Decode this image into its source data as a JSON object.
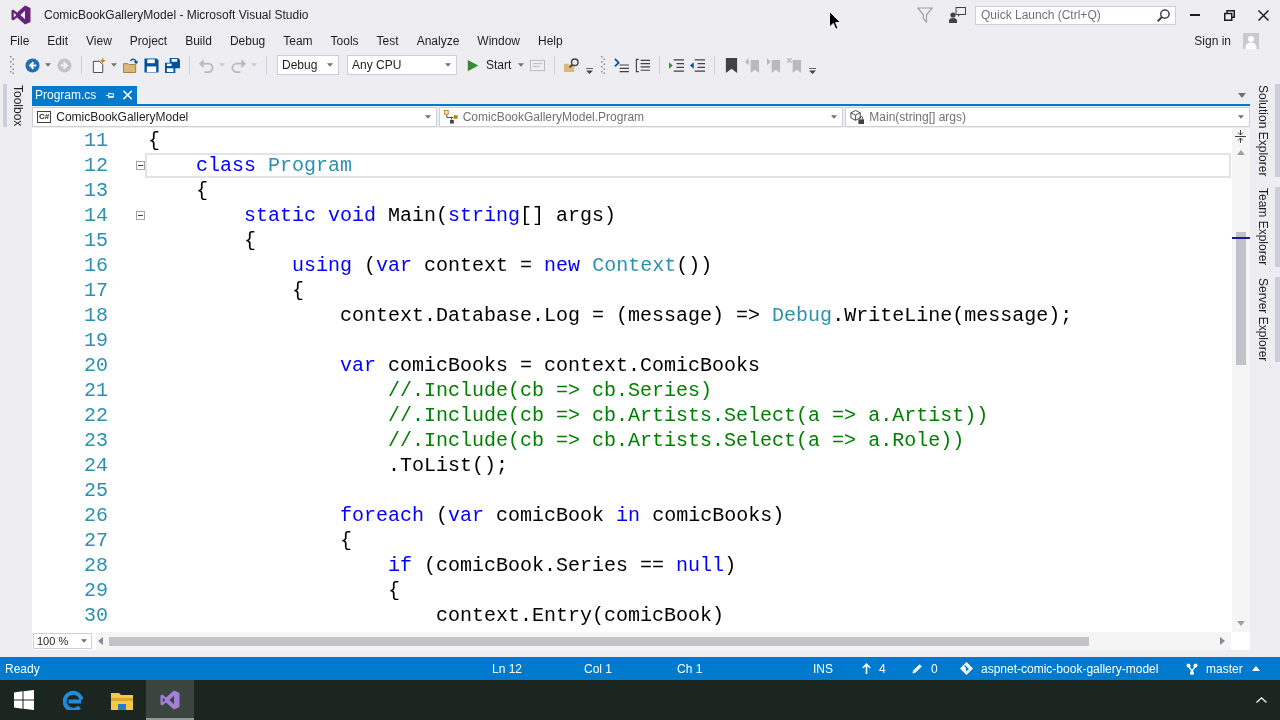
{
  "window": {
    "title": "ComicBookGalleryModel - Microsoft Visual Studio"
  },
  "quick_launch": {
    "placeholder": "Quick Launch (Ctrl+Q)"
  },
  "account": {
    "label": "Sign in"
  },
  "menu": [
    "File",
    "Edit",
    "View",
    "Project",
    "Build",
    "Debug",
    "Team",
    "Tools",
    "Test",
    "Analyze",
    "Window",
    "Help"
  ],
  "toolbars": [
    {
      "groups": [
        [
          {
            "kind": "back",
            "disabled": false,
            "menu": true
          },
          {
            "kind": "forward",
            "disabled": true,
            "menu": false
          }
        ],
        [
          {
            "kind": "new-project",
            "disabled": false,
            "menu": true
          },
          {
            "kind": "open",
            "disabled": false,
            "menu": false
          },
          {
            "kind": "save",
            "disabled": false,
            "menu": false
          },
          {
            "kind": "save-all",
            "disabled": false,
            "menu": false
          }
        ],
        [
          {
            "kind": "undo",
            "disabled": true,
            "menu": true
          },
          {
            "kind": "redo",
            "disabled": true,
            "menu": true
          }
        ],
        [
          {
            "kind": "configuration",
            "value": "Debug",
            "disabled": false,
            "menu": true
          },
          {
            "kind": "platform",
            "value": "Any CPU",
            "disabled": false,
            "menu": true
          },
          {
            "kind": "start",
            "label": "Start",
            "disabled": false,
            "menu": true
          },
          {
            "kind": "attach",
            "disabled": true,
            "menu": false
          }
        ],
        [
          {
            "kind": "find",
            "disabled": false,
            "menu": false
          },
          {
            "kind": "overflow",
            "disabled": false,
            "menu": false
          }
        ]
      ]
    },
    {
      "groups": [
        [
          {
            "kind": "step",
            "disabled": false,
            "menu": false
          },
          {
            "kind": "list",
            "disabled": false,
            "menu": false
          }
        ],
        [
          {
            "kind": "indent",
            "disabled": false,
            "menu": false
          },
          {
            "kind": "outdent",
            "disabled": false,
            "menu": false
          }
        ],
        [
          {
            "kind": "bookmark",
            "disabled": false,
            "menu": false
          },
          {
            "kind": "bookmark-prev",
            "disabled": true,
            "menu": false
          },
          {
            "kind": "bookmark-next",
            "disabled": true,
            "menu": false
          },
          {
            "kind": "bookmark-clear",
            "disabled": true,
            "menu": false
          },
          {
            "kind": "overflow",
            "disabled": false,
            "menu": false
          }
        ]
      ]
    }
  ],
  "side_tabs": {
    "left": [
      {
        "label": "Toolbox"
      }
    ],
    "right": [
      {
        "label": "Solution Explorer"
      },
      {
        "label": "Team Explorer"
      },
      {
        "label": "Server Explorer"
      }
    ]
  },
  "document_tabs": [
    {
      "label": "Program.cs",
      "selected": true
    }
  ],
  "navigation_bar": [
    {
      "kind": "project",
      "icon_text": "C#",
      "value": "ComicBookGalleryModel"
    },
    {
      "kind": "type",
      "value": "ComicBookGalleryModel.Program"
    },
    {
      "kind": "member",
      "value": "Main(string[] args)"
    }
  ],
  "editor": {
    "lines": [
      {
        "number": "11",
        "collapsible": false,
        "current": false,
        "code": [
          {
            "text": "{",
            "kind": "plain"
          }
        ]
      },
      {
        "number": "12",
        "collapsible": true,
        "current": true,
        "code": [
          {
            "text": "    class ",
            "kind": "keyword"
          },
          {
            "text": "Program",
            "kind": "type"
          }
        ]
      },
      {
        "number": "13",
        "collapsible": false,
        "current": false,
        "code": [
          {
            "text": "    {",
            "kind": "plain"
          }
        ]
      },
      {
        "number": "14",
        "collapsible": true,
        "current": false,
        "code": [
          {
            "text": "        static void ",
            "kind": "keyword"
          },
          {
            "text": "Main(",
            "kind": "plain"
          },
          {
            "text": "string",
            "kind": "keyword"
          },
          {
            "text": "[] args)",
            "kind": "plain"
          }
        ]
      },
      {
        "number": "15",
        "collapsible": false,
        "current": false,
        "code": [
          {
            "text": "        {",
            "kind": "plain"
          }
        ]
      },
      {
        "number": "16",
        "collapsible": false,
        "current": false,
        "code": [
          {
            "text": "            using",
            "kind": "keyword"
          },
          {
            "text": " (",
            "kind": "plain"
          },
          {
            "text": "var",
            "kind": "keyword"
          },
          {
            "text": " context = ",
            "kind": "plain"
          },
          {
            "text": "new ",
            "kind": "keyword"
          },
          {
            "text": "Context",
            "kind": "type"
          },
          {
            "text": "())",
            "kind": "plain"
          }
        ]
      },
      {
        "number": "17",
        "collapsible": false,
        "current": false,
        "code": [
          {
            "text": "            {",
            "kind": "plain"
          }
        ]
      },
      {
        "number": "18",
        "collapsible": false,
        "current": false,
        "code": [
          {
            "text": "                context.Database.Log = (message) => ",
            "kind": "plain"
          },
          {
            "text": "Debug",
            "kind": "type"
          },
          {
            "text": ".WriteLine(message);",
            "kind": "plain"
          }
        ]
      },
      {
        "number": "19",
        "collapsible": false,
        "current": false
      },
      {
        "number": "20",
        "collapsible": false,
        "current": false,
        "code": [
          {
            "text": "                var",
            "kind": "keyword"
          },
          {
            "text": " comicBooks = context.ComicBooks",
            "kind": "plain"
          }
        ]
      },
      {
        "number": "21",
        "collapsible": false,
        "current": false,
        "code": [
          {
            "text": "                    //.Include(cb => cb.Series)",
            "kind": "comment"
          }
        ]
      },
      {
        "number": "22",
        "collapsible": false,
        "current": false,
        "code": [
          {
            "text": "                    //.Include(cb => cb.Artists.Select(a => a.Artist))",
            "kind": "comment"
          }
        ]
      },
      {
        "number": "23",
        "collapsible": false,
        "current": false,
        "code": [
          {
            "text": "                    //.Include(cb => cb.Artists.Select(a => a.Role))",
            "kind": "comment"
          }
        ]
      },
      {
        "number": "24",
        "collapsible": false,
        "current": false,
        "code": [
          {
            "text": "                    .ToList();",
            "kind": "plain"
          }
        ]
      },
      {
        "number": "25",
        "collapsible": false,
        "current": false
      },
      {
        "number": "26",
        "collapsible": false,
        "current": false,
        "code": [
          {
            "text": "                foreach",
            "kind": "keyword"
          },
          {
            "text": " (",
            "kind": "plain"
          },
          {
            "text": "var",
            "kind": "keyword"
          },
          {
            "text": " comicBook ",
            "kind": "plain"
          },
          {
            "text": "in",
            "kind": "keyword"
          },
          {
            "text": " comicBooks)",
            "kind": "plain"
          }
        ]
      },
      {
        "number": "27",
        "collapsible": false,
        "current": false,
        "code": [
          {
            "text": "                {",
            "kind": "plain"
          }
        ]
      },
      {
        "number": "28",
        "collapsible": false,
        "current": false,
        "code": [
          {
            "text": "                    if",
            "kind": "keyword"
          },
          {
            "text": " (comicBook.Series == ",
            "kind": "plain"
          },
          {
            "text": "null",
            "kind": "keyword"
          },
          {
            "text": ")",
            "kind": "plain"
          }
        ]
      },
      {
        "number": "29",
        "collapsible": false,
        "current": false,
        "code": [
          {
            "text": "                    {",
            "kind": "plain"
          }
        ]
      },
      {
        "number": "30",
        "collapsible": false,
        "current": false,
        "code": [
          {
            "text": "                        context.Entry(comicBook)",
            "kind": "plain"
          }
        ]
      }
    ],
    "zoom": "100 %"
  },
  "status_bar": {
    "message": "Ready",
    "line": "Ln 12",
    "column": "Col 1",
    "char": "Ch 1",
    "mode": "INS",
    "unpushed": "4",
    "changes": "0",
    "repository": "aspnet-comic-book-gallery-model",
    "branch": "master"
  },
  "taskbar": [
    {
      "kind": "start",
      "selected": false
    },
    {
      "kind": "edge",
      "selected": false
    },
    {
      "kind": "explorer",
      "selected": false
    },
    {
      "kind": "visual-studio",
      "selected": true
    }
  ]
}
